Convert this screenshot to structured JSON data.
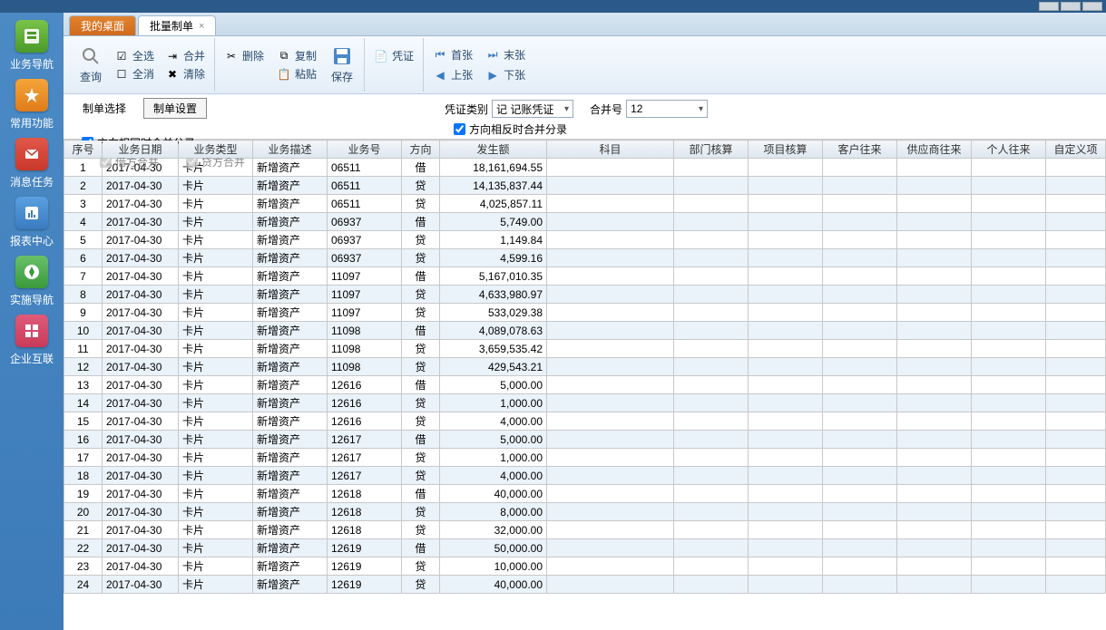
{
  "window": {
    "title": ""
  },
  "sidebar": {
    "items": [
      {
        "label": "业务导航"
      },
      {
        "label": "常用功能"
      },
      {
        "label": "消息任务"
      },
      {
        "label": "报表中心"
      },
      {
        "label": "实施导航"
      },
      {
        "label": "企业互联"
      }
    ]
  },
  "tabs": [
    {
      "label": "我的桌面",
      "active": false
    },
    {
      "label": "批量制单",
      "active": true
    }
  ],
  "toolbar": {
    "query": "查询",
    "select_all": "全选",
    "deselect_all": "全消",
    "merge": "合并",
    "clear": "清除",
    "delete": "删除",
    "copy": "复制",
    "paste": "粘贴",
    "save": "保存",
    "voucher": "凭证",
    "first": "首张",
    "last": "末张",
    "prev": "上张",
    "next": "下张"
  },
  "subtabs": {
    "select": "制单选择",
    "settings": "制单设置"
  },
  "filters": {
    "same_dir_merge": "方向相同时合并分录",
    "debit_merge": "借方合并",
    "credit_merge": "贷方合并",
    "opposite_dir_merge": "方向相反时合并分录",
    "voucher_type_label": "凭证类别",
    "voucher_type_value": "记 记账凭证",
    "merge_no_label": "合并号",
    "merge_no_value": "12"
  },
  "grid": {
    "columns": [
      "序号",
      "业务日期",
      "业务类型",
      "业务描述",
      "业务号",
      "方向",
      "发生额",
      "科目",
      "部门核算",
      "项目核算",
      "客户往来",
      "供应商往来",
      "个人往来",
      "自定义项"
    ],
    "rows": [
      {
        "seq": 1,
        "date": "2017-04-30",
        "type": "卡片",
        "desc": "新增资产",
        "num": "06511",
        "dir": "借",
        "amt": "18,161,694.55"
      },
      {
        "seq": 2,
        "date": "2017-04-30",
        "type": "卡片",
        "desc": "新增资产",
        "num": "06511",
        "dir": "贷",
        "amt": "14,135,837.44"
      },
      {
        "seq": 3,
        "date": "2017-04-30",
        "type": "卡片",
        "desc": "新增资产",
        "num": "06511",
        "dir": "贷",
        "amt": "4,025,857.11"
      },
      {
        "seq": 4,
        "date": "2017-04-30",
        "type": "卡片",
        "desc": "新增资产",
        "num": "06937",
        "dir": "借",
        "amt": "5,749.00"
      },
      {
        "seq": 5,
        "date": "2017-04-30",
        "type": "卡片",
        "desc": "新增资产",
        "num": "06937",
        "dir": "贷",
        "amt": "1,149.84"
      },
      {
        "seq": 6,
        "date": "2017-04-30",
        "type": "卡片",
        "desc": "新增资产",
        "num": "06937",
        "dir": "贷",
        "amt": "4,599.16"
      },
      {
        "seq": 7,
        "date": "2017-04-30",
        "type": "卡片",
        "desc": "新增资产",
        "num": "11097",
        "dir": "借",
        "amt": "5,167,010.35"
      },
      {
        "seq": 8,
        "date": "2017-04-30",
        "type": "卡片",
        "desc": "新增资产",
        "num": "11097",
        "dir": "贷",
        "amt": "4,633,980.97"
      },
      {
        "seq": 9,
        "date": "2017-04-30",
        "type": "卡片",
        "desc": "新增资产",
        "num": "11097",
        "dir": "贷",
        "amt": "533,029.38"
      },
      {
        "seq": 10,
        "date": "2017-04-30",
        "type": "卡片",
        "desc": "新增资产",
        "num": "11098",
        "dir": "借",
        "amt": "4,089,078.63"
      },
      {
        "seq": 11,
        "date": "2017-04-30",
        "type": "卡片",
        "desc": "新增资产",
        "num": "11098",
        "dir": "贷",
        "amt": "3,659,535.42"
      },
      {
        "seq": 12,
        "date": "2017-04-30",
        "type": "卡片",
        "desc": "新增资产",
        "num": "11098",
        "dir": "贷",
        "amt": "429,543.21"
      },
      {
        "seq": 13,
        "date": "2017-04-30",
        "type": "卡片",
        "desc": "新增资产",
        "num": "12616",
        "dir": "借",
        "amt": "5,000.00"
      },
      {
        "seq": 14,
        "date": "2017-04-30",
        "type": "卡片",
        "desc": "新增资产",
        "num": "12616",
        "dir": "贷",
        "amt": "1,000.00"
      },
      {
        "seq": 15,
        "date": "2017-04-30",
        "type": "卡片",
        "desc": "新增资产",
        "num": "12616",
        "dir": "贷",
        "amt": "4,000.00"
      },
      {
        "seq": 16,
        "date": "2017-04-30",
        "type": "卡片",
        "desc": "新增资产",
        "num": "12617",
        "dir": "借",
        "amt": "5,000.00"
      },
      {
        "seq": 17,
        "date": "2017-04-30",
        "type": "卡片",
        "desc": "新增资产",
        "num": "12617",
        "dir": "贷",
        "amt": "1,000.00"
      },
      {
        "seq": 18,
        "date": "2017-04-30",
        "type": "卡片",
        "desc": "新增资产",
        "num": "12617",
        "dir": "贷",
        "amt": "4,000.00"
      },
      {
        "seq": 19,
        "date": "2017-04-30",
        "type": "卡片",
        "desc": "新增资产",
        "num": "12618",
        "dir": "借",
        "amt": "40,000.00"
      },
      {
        "seq": 20,
        "date": "2017-04-30",
        "type": "卡片",
        "desc": "新增资产",
        "num": "12618",
        "dir": "贷",
        "amt": "8,000.00"
      },
      {
        "seq": 21,
        "date": "2017-04-30",
        "type": "卡片",
        "desc": "新增资产",
        "num": "12618",
        "dir": "贷",
        "amt": "32,000.00"
      },
      {
        "seq": 22,
        "date": "2017-04-30",
        "type": "卡片",
        "desc": "新增资产",
        "num": "12619",
        "dir": "借",
        "amt": "50,000.00"
      },
      {
        "seq": 23,
        "date": "2017-04-30",
        "type": "卡片",
        "desc": "新增资产",
        "num": "12619",
        "dir": "贷",
        "amt": "10,000.00"
      },
      {
        "seq": 24,
        "date": "2017-04-30",
        "type": "卡片",
        "desc": "新增资产",
        "num": "12619",
        "dir": "贷",
        "amt": "40,000.00"
      }
    ]
  }
}
